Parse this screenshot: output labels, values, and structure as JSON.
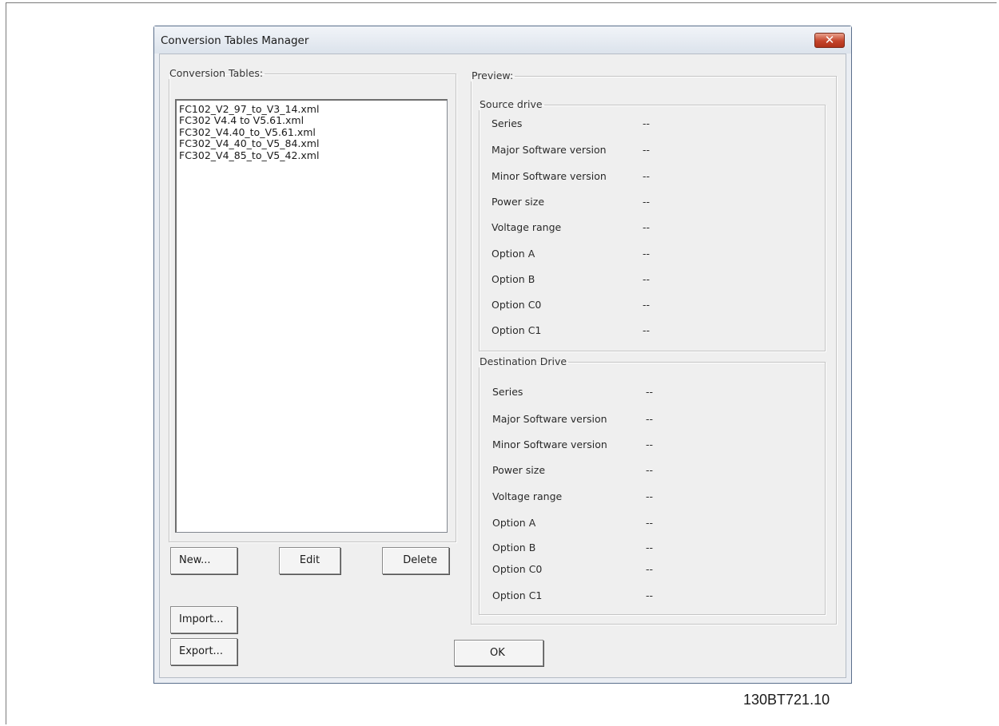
{
  "window": {
    "title": "Conversion Tables Manager",
    "close_icon": "close-icon"
  },
  "tables_group": {
    "legend": "Conversion Tables:",
    "items": [
      "FC102_V2_97_to_V3_14.xml",
      "FC302 V4.4 to V5.61.xml",
      "FC302_V4.40_to_V5.61.xml",
      "FC302_V4_40_to_V5_84.xml",
      "FC302_V4_85_to_V5_42.xml"
    ],
    "new_label": "New...",
    "edit_label": "Edit",
    "delete_label": "Delete",
    "import_label": "Import...",
    "export_label": "Export..."
  },
  "preview": {
    "legend": "Preview:",
    "source": {
      "legend": "Source drive",
      "rows": [
        {
          "label": "Series",
          "value": "--"
        },
        {
          "label": "Major Software version",
          "value": "--"
        },
        {
          "label": "Minor Software version",
          "value": "--"
        },
        {
          "label": "Power size",
          "value": "--"
        },
        {
          "label": "Voltage range",
          "value": "--"
        },
        {
          "label": "Option A",
          "value": "--"
        },
        {
          "label": "Option B",
          "value": "--"
        },
        {
          "label": "Option C0",
          "value": "--"
        },
        {
          "label": "Option C1",
          "value": "--"
        }
      ]
    },
    "destination": {
      "legend": "Destination Drive",
      "rows": [
        {
          "label": "Series",
          "value": "--"
        },
        {
          "label": "Major Software version",
          "value": "--"
        },
        {
          "label": "Minor Software version",
          "value": "--"
        },
        {
          "label": "Power size",
          "value": "--"
        },
        {
          "label": "Voltage range",
          "value": "--"
        },
        {
          "label": "Option A",
          "value": "--"
        },
        {
          "label": "Option B",
          "value": "--"
        },
        {
          "label": "Option C0",
          "value": "--"
        },
        {
          "label": "Option C1",
          "value": "--"
        }
      ]
    }
  },
  "ok_label": "OK",
  "figure_id": "130BT721.10"
}
